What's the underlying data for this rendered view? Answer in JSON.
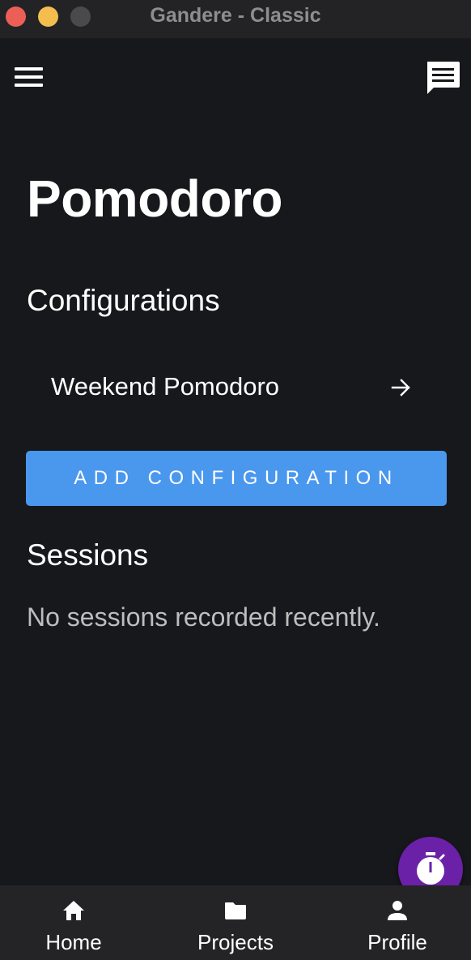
{
  "window": {
    "title": "Gandere - Classic"
  },
  "header": {
    "menu_icon": "hamburger-menu-icon",
    "chat_icon": "chat-feedback-icon"
  },
  "page": {
    "title": "Pomodoro"
  },
  "configurations": {
    "heading": "Configurations",
    "items": [
      {
        "label": "Weekend Pomodoro",
        "icon": "arrow-right-icon"
      }
    ],
    "add_button_label": "ADD CONFIGURATION"
  },
  "sessions": {
    "heading": "Sessions",
    "empty_text": "No sessions recorded recently."
  },
  "fab": {
    "icon": "stopwatch-icon",
    "color": "#6a21a8"
  },
  "bottom_nav": {
    "items": [
      {
        "label": "Home",
        "icon": "home-icon"
      },
      {
        "label": "Projects",
        "icon": "folder-icon"
      },
      {
        "label": "Profile",
        "icon": "person-icon"
      }
    ]
  },
  "colors": {
    "background": "#17181b",
    "accent": "#4a97ee",
    "nav_background": "#242426"
  }
}
